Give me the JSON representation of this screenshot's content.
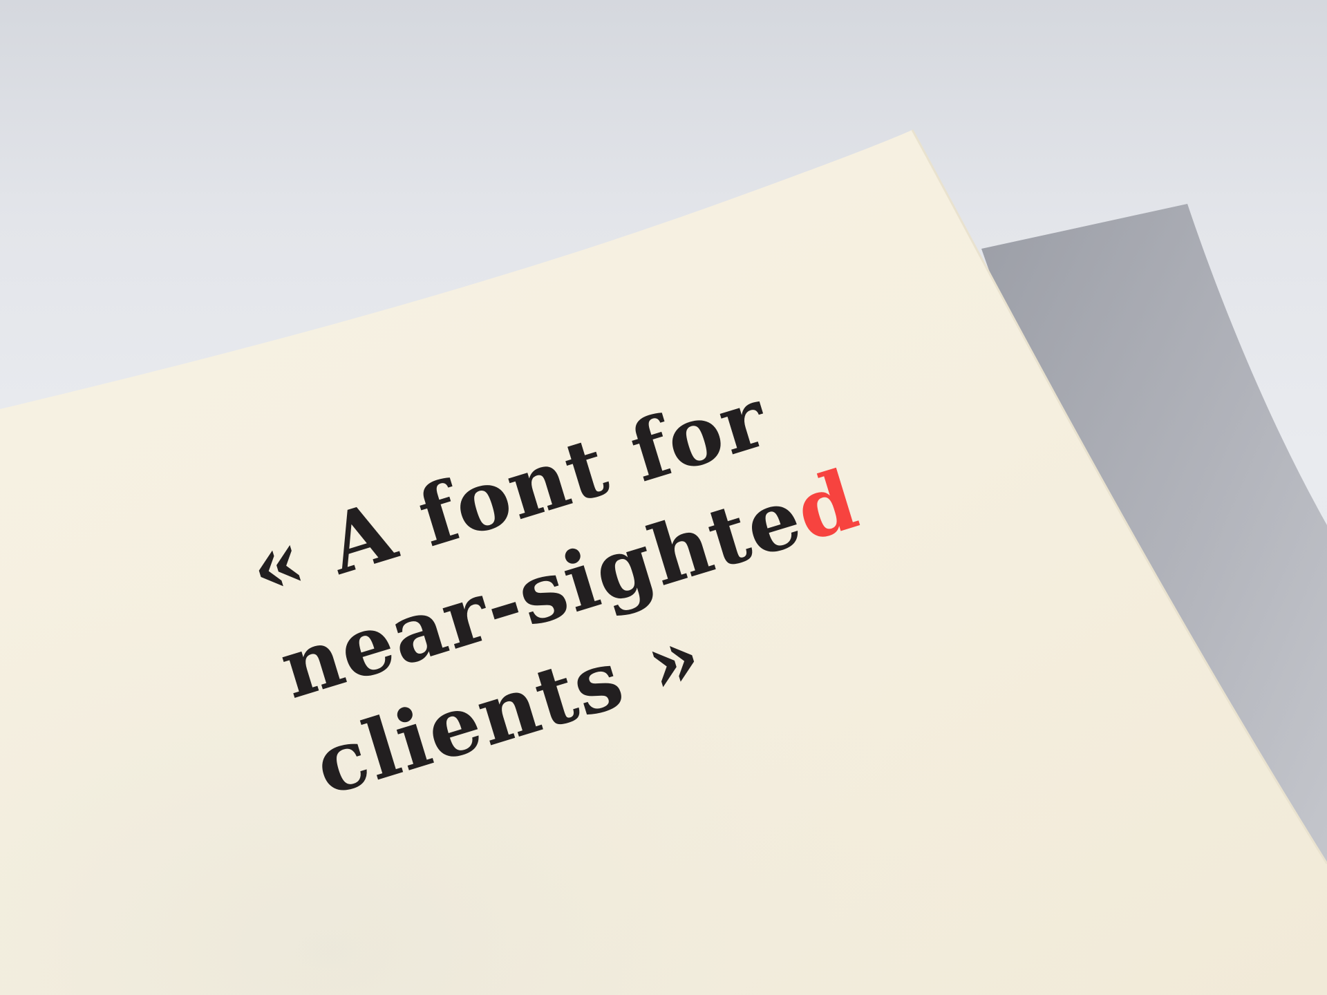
{
  "quote": {
    "open_mark": "«",
    "line1": "A font for",
    "line2_main": "near-sighte",
    "line2_accent": "d",
    "line3": "clients",
    "close_mark": "»"
  },
  "colors": {
    "text": "#221f20",
    "accent": "#f7433f",
    "paper": "#f6f1e2",
    "background": "#e6e8ec",
    "shadow": "#a9abb3"
  }
}
